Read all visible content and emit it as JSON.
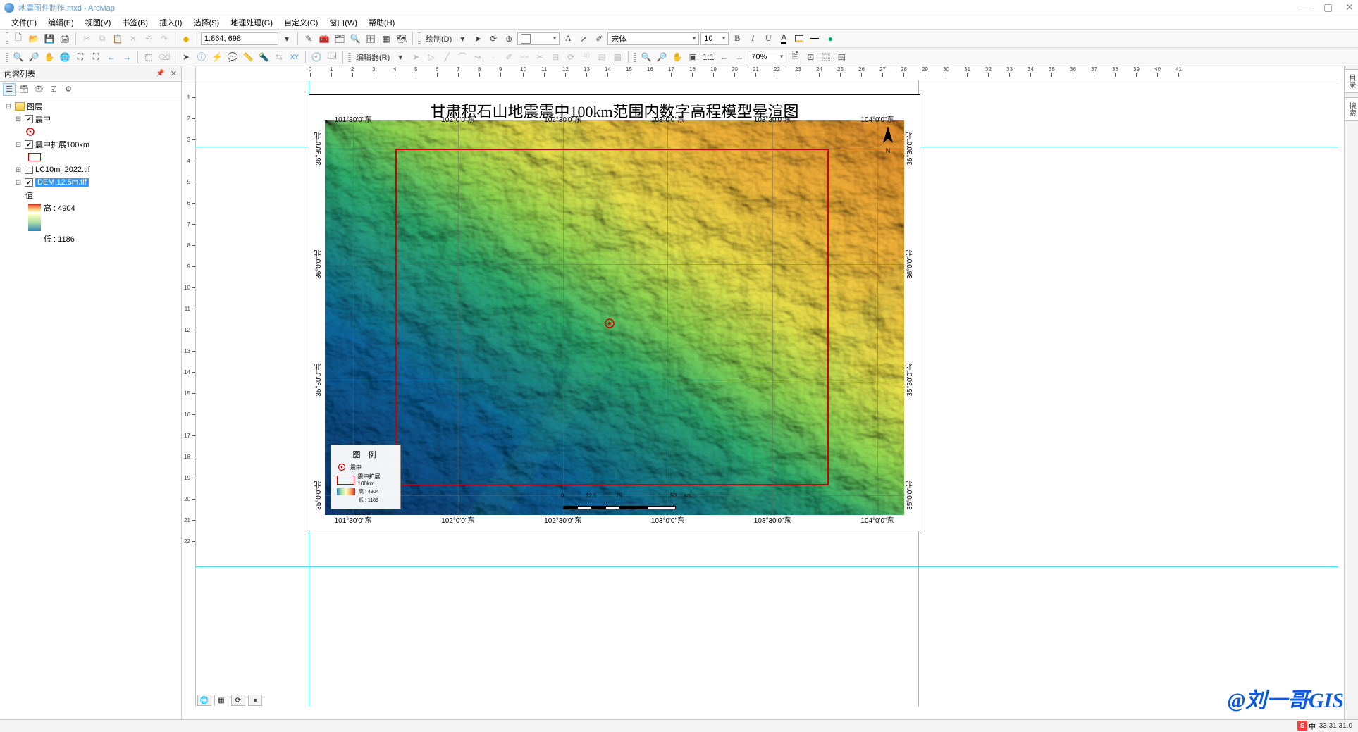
{
  "title": "地震图件制作.mxd - ArcMap",
  "menubar": [
    "文件(F)",
    "编辑(E)",
    "视图(V)",
    "书签(B)",
    "插入(I)",
    "选择(S)",
    "地理处理(G)",
    "自定义(C)",
    "窗口(W)",
    "帮助(H)"
  ],
  "toolbar1": {
    "scale": "1:864, 698",
    "draw_label": "绘制(D)",
    "font_family": "宋体",
    "font_size": "10",
    "bold": "B",
    "italic": "I",
    "underline": "U"
  },
  "toolbar2": {
    "editor_label": "编辑器(R)",
    "zoom_pct": "70%"
  },
  "toc": {
    "title": "内容列表",
    "root": "图层",
    "layers": [
      {
        "name": "震中",
        "checked": true,
        "symbol": "point-red-circle"
      },
      {
        "name": "震中扩展100km",
        "checked": true,
        "symbol": "box-red"
      },
      {
        "name": "LC10m_2022.tif",
        "checked": false,
        "symbol": null
      },
      {
        "name": "DEM 12.5m.tif",
        "checked": true,
        "symbol": "ramp",
        "selected": true,
        "value_label": "值",
        "high": "高 : 4904",
        "low": "低 : 1186"
      }
    ]
  },
  "ruler_h": [
    0,
    1,
    2,
    3,
    4,
    5,
    6,
    7,
    8,
    9,
    10,
    11,
    12,
    13,
    14,
    15,
    16,
    17,
    18,
    19,
    20,
    21,
    22,
    23,
    24,
    25,
    26,
    27,
    28,
    29,
    30,
    31,
    32,
    33,
    34,
    35,
    36,
    37,
    38,
    39,
    40,
    41
  ],
  "ruler_v": [
    1,
    2,
    3,
    4,
    5,
    6,
    7,
    8,
    9,
    10,
    11,
    12,
    13,
    14,
    15,
    16,
    17,
    18,
    19,
    20,
    21,
    22
  ],
  "map": {
    "title": "甘肃积石山地震震中100km范围内数字高程模型晕渲图",
    "lon_labels": [
      "101°30'0\"东",
      "102°0'0\"东",
      "102°30'0\"东",
      "103°0'0\"东",
      "103°30'0\"东",
      "104°0'0\"东"
    ],
    "lat_labels": [
      "36°30'0\"北",
      "36°0'0\"北",
      "35°30'0\"北",
      "35°0'0\"北"
    ],
    "legend": {
      "title": "图 例",
      "rows": [
        {
          "sym": "point",
          "label": "震中"
        },
        {
          "sym": "rect",
          "label": "震中扩展100km"
        },
        {
          "sym": "ramp",
          "label_hi": "高 : 4904",
          "label_lo": "低 : 1186"
        }
      ]
    },
    "scalebar_ticks": [
      "0",
      "12.5",
      "25",
      "50"
    ],
    "scalebar_unit": "km"
  },
  "dock_tabs": [
    "目录",
    "搜索"
  ],
  "statusbar": {
    "coords": "33.31  31.0"
  },
  "watermark": "@刘一哥GIS",
  "ime": {
    "badge": "S",
    "lang": "中"
  }
}
